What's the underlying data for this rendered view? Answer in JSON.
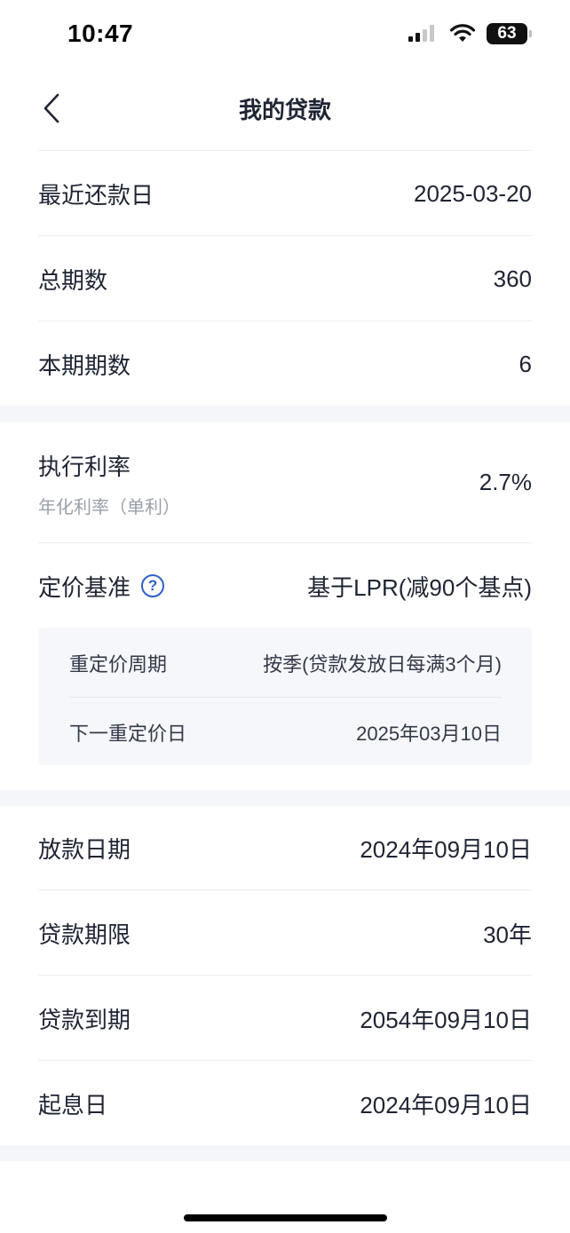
{
  "status_bar": {
    "time": "10:47",
    "battery": "63"
  },
  "nav": {
    "title": "我的贷款"
  },
  "section1": {
    "rows": [
      {
        "label": "最近还款日",
        "value": "2025-03-20"
      },
      {
        "label": "总期数",
        "value": "360"
      },
      {
        "label": "本期期数",
        "value": "6"
      }
    ]
  },
  "section2": {
    "rate": {
      "label": "执行利率",
      "sub_label": "年化利率（单利）",
      "value": "2.7%"
    },
    "pricing": {
      "label": "定价基准",
      "help": "?",
      "value": "基于LPR(减90个基点)"
    },
    "details": [
      {
        "label": "重定价周期",
        "value": "按季(贷款发放日每满3个月)"
      },
      {
        "label": "下一重定价日",
        "value": "2025年03月10日"
      }
    ]
  },
  "section3": {
    "rows": [
      {
        "label": "放款日期",
        "value": "2024年09月10日"
      },
      {
        "label": "贷款期限",
        "value": "30年"
      },
      {
        "label": "贷款到期",
        "value": "2054年09月10日"
      },
      {
        "label": "起息日",
        "value": "2024年09月10日"
      }
    ]
  }
}
